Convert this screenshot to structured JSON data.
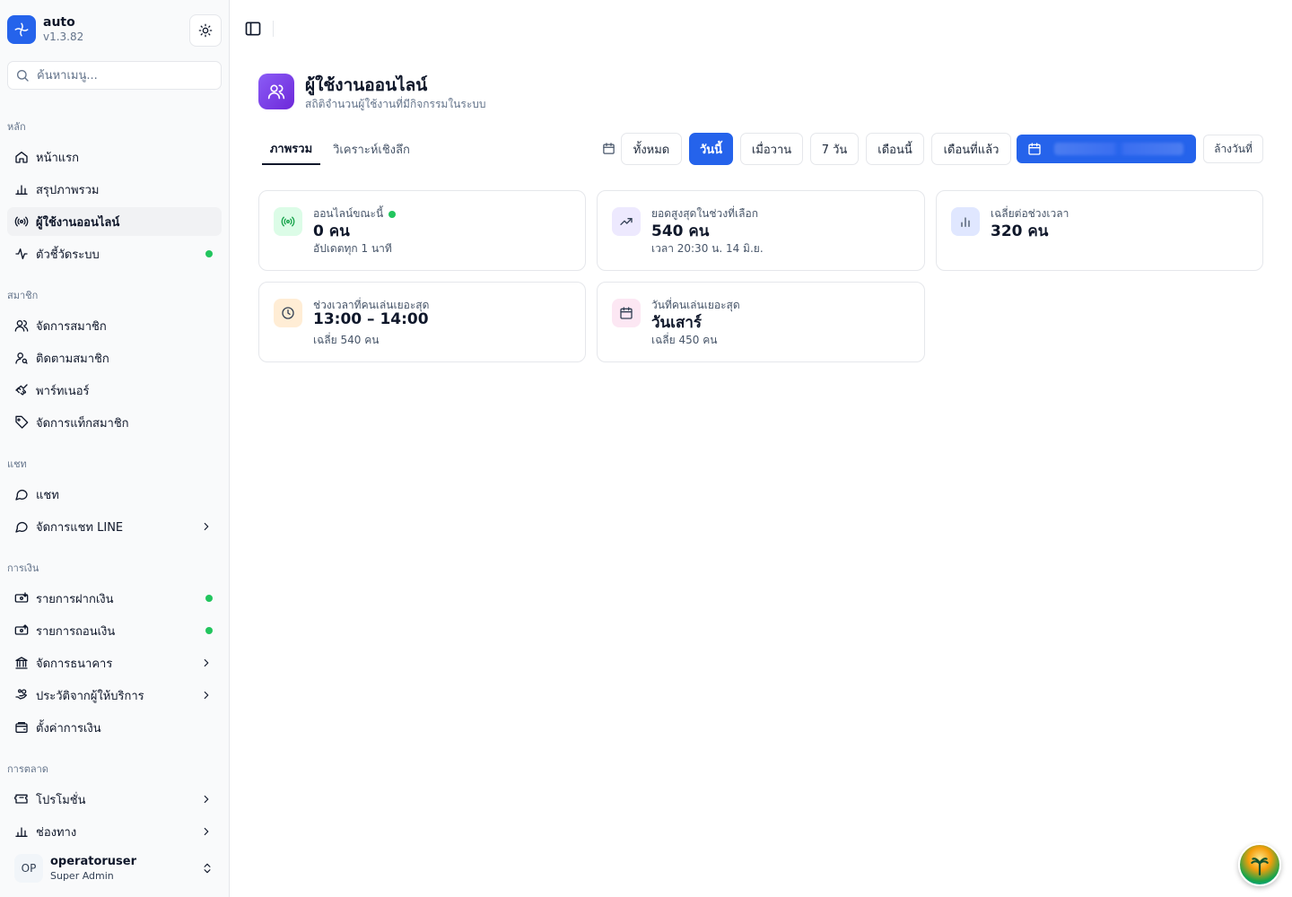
{
  "app": {
    "name": "auto",
    "version": "v1.3.82"
  },
  "search": {
    "placeholder": "ค้นหาเมนู..."
  },
  "sidebar": {
    "groups": [
      {
        "label": "หลัก",
        "items": [
          {
            "label": "หน้าแรก",
            "icon": "home-icon"
          },
          {
            "label": "สรุปภาพรวม",
            "icon": "bar-chart-icon"
          },
          {
            "label": "ผู้ใช้งานออนไลน์",
            "icon": "broadcast-icon",
            "active": true
          },
          {
            "label": "ตัวชี้วัดระบบ",
            "icon": "activity-icon",
            "status_dot": true
          }
        ]
      },
      {
        "label": "สมาชิก",
        "items": [
          {
            "label": "จัดการสมาชิก",
            "icon": "users-icon"
          },
          {
            "label": "ติดตามสมาชิก",
            "icon": "user-search-icon"
          },
          {
            "label": "พาร์ทเนอร์",
            "icon": "handshake-icon"
          },
          {
            "label": "จัดการแท็กสมาชิก",
            "icon": "tag-icon"
          }
        ]
      },
      {
        "label": "แชท",
        "items": [
          {
            "label": "แชท",
            "icon": "message-circle-icon"
          },
          {
            "label": "จัดการแชท LINE",
            "icon": "message-circle-icon",
            "chevron": true
          }
        ]
      },
      {
        "label": "การเงิน",
        "items": [
          {
            "label": "รายการฝากเงิน",
            "icon": "deposit-icon",
            "status_dot": true
          },
          {
            "label": "รายการถอนเงิน",
            "icon": "withdraw-icon",
            "status_dot": true
          },
          {
            "label": "จัดการธนาคาร",
            "icon": "bank-icon",
            "chevron": true
          },
          {
            "label": "ประวัติจากผู้ให้บริการ",
            "icon": "hand-coins-icon",
            "chevron": true
          },
          {
            "label": "ตั้งค่าการเงิน",
            "icon": "wallet-icon"
          }
        ]
      },
      {
        "label": "การตลาด",
        "items": [
          {
            "label": "โปรโมชั่น",
            "icon": "ticket-icon",
            "chevron": true
          },
          {
            "label": "ช่องทาง",
            "icon": "bar-chart-icon",
            "chevron": true
          }
        ]
      }
    ]
  },
  "user": {
    "initials": "OP",
    "name": "operatoruser",
    "role": "Super Admin"
  },
  "page": {
    "title": "ผู้ใช้งานออนไลน์",
    "subtitle": "สถิติจำนวนผู้ใช้งานที่มีกิจกรรมในระบบ"
  },
  "tabs": [
    {
      "label": "ภาพรวม",
      "active": true
    },
    {
      "label": "วิเคราะห์เชิงลึก",
      "active": false
    }
  ],
  "filters": [
    {
      "label": "ทั้งหมด"
    },
    {
      "label": "วันนี้",
      "active": true
    },
    {
      "label": "เมื่อวาน"
    },
    {
      "label": "7 วัน"
    },
    {
      "label": "เดือนนี้"
    },
    {
      "label": "เดือนที่แล้ว"
    }
  ],
  "clear_dates_label": "ล้างวันที่",
  "cards": [
    {
      "label": "ออนไลน์ขณะนี้",
      "value": "0 คน",
      "sub": "อัปเดตทุก 1 นาที",
      "icon": "broadcast-icon",
      "live": true
    },
    {
      "label": "ยอดสูงสุดในช่วงที่เลือก",
      "value": "540 คน",
      "sub": "เวลา 20:30 น. 14 มิ.ย.",
      "icon": "trending-up-icon"
    },
    {
      "label": "เฉลี่ยต่อช่วงเวลา",
      "value": "320 คน",
      "sub": "",
      "icon": "bar-chart-icon"
    },
    {
      "label": "ช่วงเวลาที่คนเล่นเยอะสุด",
      "value": "13:00 – 14:00",
      "sub": "เฉลี่ย 540 คน",
      "icon": "clock-icon"
    },
    {
      "label": "วันที่คนเล่นเยอะสุด",
      "value": "วันเสาร์",
      "sub": "เฉลี่ย 450 คน",
      "icon": "calendar-icon"
    }
  ],
  "colors": {
    "accent": "#2563eb",
    "success": "#22c55e",
    "violet": "#7c3aed"
  }
}
